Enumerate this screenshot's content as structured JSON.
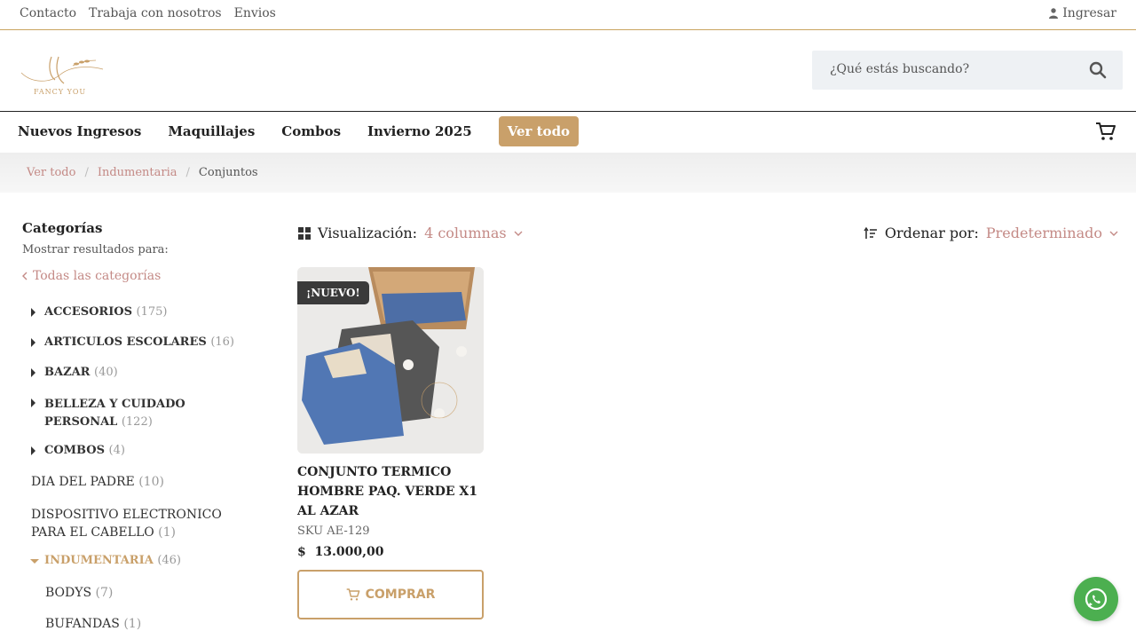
{
  "topbar": {
    "links": [
      "Contacto",
      "Trabaja con nosotros",
      "Envios"
    ],
    "login": "Ingresar"
  },
  "brand": {
    "logo_text": "FANCY YOU"
  },
  "search": {
    "placeholder": "¿Qué estás buscando?"
  },
  "nav": {
    "items": [
      "Nuevos Ingresos",
      "Maquillajes",
      "Combos",
      "Invierno 2025"
    ],
    "cta": "Ver todo"
  },
  "breadcrumb": {
    "items": [
      "Ver todo",
      "Indumentaria",
      "Conjuntos"
    ]
  },
  "sidebar": {
    "title": "Categorías",
    "subtitle": "Mostrar resultados para:",
    "all": "Todas las categorías",
    "categories": [
      {
        "name": "ACCESORIOS",
        "count": "(175)"
      },
      {
        "name": "ARTICULOS ESCOLARES",
        "count": "(16)"
      },
      {
        "name": "BAZAR",
        "count": "(40)"
      },
      {
        "name": "BELLEZA Y CUIDADO PERSONAL",
        "count": "(122)"
      },
      {
        "name": "COMBOS",
        "count": "(4)"
      },
      {
        "name": "DIA DEL PADRE",
        "count": "(10)"
      },
      {
        "name": "DISPOSITIVO ELECTRONICO PARA EL CABELLO",
        "count": "(1)"
      },
      {
        "name": "INDUMENTARIA",
        "count": "(46)"
      },
      {
        "name": "BODYS",
        "count": "(7)"
      },
      {
        "name": "BUFANDAS",
        "count": "(1)"
      }
    ]
  },
  "toolbar": {
    "view_label": "Visualización:",
    "view_value": "4 columnas",
    "sort_label": "Ordenar por:",
    "sort_value": "Predeterminado"
  },
  "product": {
    "badge": "¡NUEVO!",
    "title": "CONJUNTO TERMICO HOMBRE PAQ. VERDE X1 AL AZAR",
    "sku": "SKU AE-129",
    "currency": "$",
    "price": "13.000,00",
    "buy_label": "COMPRAR"
  },
  "colors": {
    "accent": "#c9a06a",
    "link": "#c48a86",
    "whatsapp": "#4caf50"
  }
}
